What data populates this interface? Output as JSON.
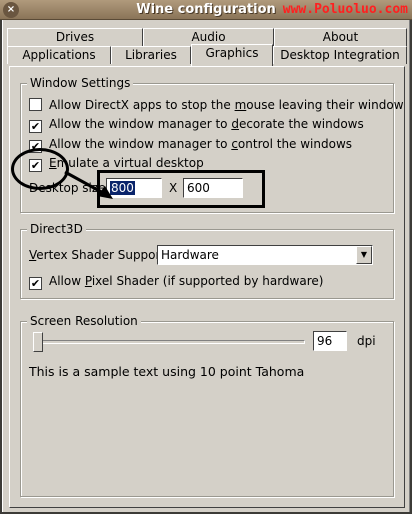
{
  "window": {
    "title": "Wine configuration",
    "watermark": "www.Poluoluo.com",
    "close_glyph": "×"
  },
  "tabs_top": [
    {
      "label": "Drives"
    },
    {
      "label": "Audio"
    },
    {
      "label": "About"
    }
  ],
  "tabs_bottom": [
    {
      "label": "Applications"
    },
    {
      "label": "Libraries"
    },
    {
      "label": "Graphics",
      "active": true
    },
    {
      "label": "Desktop Integration"
    }
  ],
  "window_settings": {
    "title": "Window Settings",
    "options": [
      {
        "pre": "Allow DirectX apps to stop the ",
        "ul": "m",
        "post": "ouse leaving their window",
        "checked": false
      },
      {
        "pre": "Allow the window manager to ",
        "ul": "d",
        "post": "ecorate the windows",
        "checked": true
      },
      {
        "pre": "Allow the window manager to ",
        "ul": "c",
        "post": "ontrol the windows",
        "checked": true
      },
      {
        "pre": "",
        "ul": "E",
        "post": "mulate a virtual desktop",
        "checked": true
      }
    ],
    "desktop_size_label": "Desktop size:",
    "width": "800",
    "x_label": "X",
    "height": "600"
  },
  "direct3d": {
    "title": "Direct3D",
    "vertex_label_ul": "V",
    "vertex_label_rest": "ertex Shader Support:",
    "vertex_value": "Hardware",
    "pixel_pre": "Allow ",
    "pixel_ul": "P",
    "pixel_post": "ixel Shader (if supported by hardware)",
    "pixel_checked": true
  },
  "screen_resolution": {
    "title": "Screen Resolution",
    "dpi_value": "96",
    "dpi_unit": "dpi",
    "sample_text": "This is a sample text using 10 point Tahoma"
  },
  "icons": {
    "check": "✔",
    "dropdown": "▼"
  }
}
